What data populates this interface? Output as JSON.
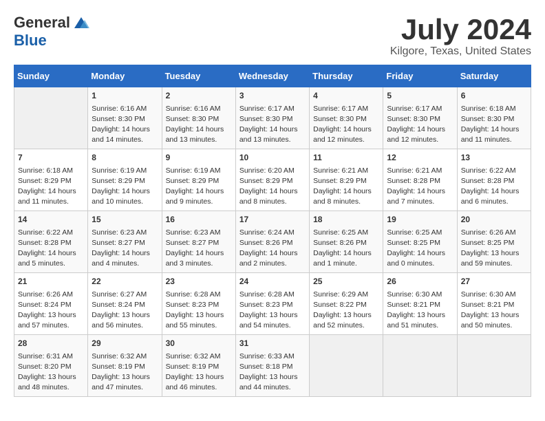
{
  "header": {
    "logo_general": "General",
    "logo_blue": "Blue",
    "month": "July 2024",
    "location": "Kilgore, Texas, United States"
  },
  "days_of_week": [
    "Sunday",
    "Monday",
    "Tuesday",
    "Wednesday",
    "Thursday",
    "Friday",
    "Saturday"
  ],
  "weeks": [
    [
      {
        "day": "",
        "lines": []
      },
      {
        "day": "1",
        "lines": [
          "Sunrise: 6:16 AM",
          "Sunset: 8:30 PM",
          "Daylight: 14 hours",
          "and 14 minutes."
        ]
      },
      {
        "day": "2",
        "lines": [
          "Sunrise: 6:16 AM",
          "Sunset: 8:30 PM",
          "Daylight: 14 hours",
          "and 13 minutes."
        ]
      },
      {
        "day": "3",
        "lines": [
          "Sunrise: 6:17 AM",
          "Sunset: 8:30 PM",
          "Daylight: 14 hours",
          "and 13 minutes."
        ]
      },
      {
        "day": "4",
        "lines": [
          "Sunrise: 6:17 AM",
          "Sunset: 8:30 PM",
          "Daylight: 14 hours",
          "and 12 minutes."
        ]
      },
      {
        "day": "5",
        "lines": [
          "Sunrise: 6:17 AM",
          "Sunset: 8:30 PM",
          "Daylight: 14 hours",
          "and 12 minutes."
        ]
      },
      {
        "day": "6",
        "lines": [
          "Sunrise: 6:18 AM",
          "Sunset: 8:30 PM",
          "Daylight: 14 hours",
          "and 11 minutes."
        ]
      }
    ],
    [
      {
        "day": "7",
        "lines": [
          "Sunrise: 6:18 AM",
          "Sunset: 8:29 PM",
          "Daylight: 14 hours",
          "and 11 minutes."
        ]
      },
      {
        "day": "8",
        "lines": [
          "Sunrise: 6:19 AM",
          "Sunset: 8:29 PM",
          "Daylight: 14 hours",
          "and 10 minutes."
        ]
      },
      {
        "day": "9",
        "lines": [
          "Sunrise: 6:19 AM",
          "Sunset: 8:29 PM",
          "Daylight: 14 hours",
          "and 9 minutes."
        ]
      },
      {
        "day": "10",
        "lines": [
          "Sunrise: 6:20 AM",
          "Sunset: 8:29 PM",
          "Daylight: 14 hours",
          "and 8 minutes."
        ]
      },
      {
        "day": "11",
        "lines": [
          "Sunrise: 6:21 AM",
          "Sunset: 8:29 PM",
          "Daylight: 14 hours",
          "and 8 minutes."
        ]
      },
      {
        "day": "12",
        "lines": [
          "Sunrise: 6:21 AM",
          "Sunset: 8:28 PM",
          "Daylight: 14 hours",
          "and 7 minutes."
        ]
      },
      {
        "day": "13",
        "lines": [
          "Sunrise: 6:22 AM",
          "Sunset: 8:28 PM",
          "Daylight: 14 hours",
          "and 6 minutes."
        ]
      }
    ],
    [
      {
        "day": "14",
        "lines": [
          "Sunrise: 6:22 AM",
          "Sunset: 8:28 PM",
          "Daylight: 14 hours",
          "and 5 minutes."
        ]
      },
      {
        "day": "15",
        "lines": [
          "Sunrise: 6:23 AM",
          "Sunset: 8:27 PM",
          "Daylight: 14 hours",
          "and 4 minutes."
        ]
      },
      {
        "day": "16",
        "lines": [
          "Sunrise: 6:23 AM",
          "Sunset: 8:27 PM",
          "Daylight: 14 hours",
          "and 3 minutes."
        ]
      },
      {
        "day": "17",
        "lines": [
          "Sunrise: 6:24 AM",
          "Sunset: 8:26 PM",
          "Daylight: 14 hours",
          "and 2 minutes."
        ]
      },
      {
        "day": "18",
        "lines": [
          "Sunrise: 6:25 AM",
          "Sunset: 8:26 PM",
          "Daylight: 14 hours",
          "and 1 minute."
        ]
      },
      {
        "day": "19",
        "lines": [
          "Sunrise: 6:25 AM",
          "Sunset: 8:25 PM",
          "Daylight: 14 hours",
          "and 0 minutes."
        ]
      },
      {
        "day": "20",
        "lines": [
          "Sunrise: 6:26 AM",
          "Sunset: 8:25 PM",
          "Daylight: 13 hours",
          "and 59 minutes."
        ]
      }
    ],
    [
      {
        "day": "21",
        "lines": [
          "Sunrise: 6:26 AM",
          "Sunset: 8:24 PM",
          "Daylight: 13 hours",
          "and 57 minutes."
        ]
      },
      {
        "day": "22",
        "lines": [
          "Sunrise: 6:27 AM",
          "Sunset: 8:24 PM",
          "Daylight: 13 hours",
          "and 56 minutes."
        ]
      },
      {
        "day": "23",
        "lines": [
          "Sunrise: 6:28 AM",
          "Sunset: 8:23 PM",
          "Daylight: 13 hours",
          "and 55 minutes."
        ]
      },
      {
        "day": "24",
        "lines": [
          "Sunrise: 6:28 AM",
          "Sunset: 8:23 PM",
          "Daylight: 13 hours",
          "and 54 minutes."
        ]
      },
      {
        "day": "25",
        "lines": [
          "Sunrise: 6:29 AM",
          "Sunset: 8:22 PM",
          "Daylight: 13 hours",
          "and 52 minutes."
        ]
      },
      {
        "day": "26",
        "lines": [
          "Sunrise: 6:30 AM",
          "Sunset: 8:21 PM",
          "Daylight: 13 hours",
          "and 51 minutes."
        ]
      },
      {
        "day": "27",
        "lines": [
          "Sunrise: 6:30 AM",
          "Sunset: 8:21 PM",
          "Daylight: 13 hours",
          "and 50 minutes."
        ]
      }
    ],
    [
      {
        "day": "28",
        "lines": [
          "Sunrise: 6:31 AM",
          "Sunset: 8:20 PM",
          "Daylight: 13 hours",
          "and 48 minutes."
        ]
      },
      {
        "day": "29",
        "lines": [
          "Sunrise: 6:32 AM",
          "Sunset: 8:19 PM",
          "Daylight: 13 hours",
          "and 47 minutes."
        ]
      },
      {
        "day": "30",
        "lines": [
          "Sunrise: 6:32 AM",
          "Sunset: 8:19 PM",
          "Daylight: 13 hours",
          "and 46 minutes."
        ]
      },
      {
        "day": "31",
        "lines": [
          "Sunrise: 6:33 AM",
          "Sunset: 8:18 PM",
          "Daylight: 13 hours",
          "and 44 minutes."
        ]
      },
      {
        "day": "",
        "lines": []
      },
      {
        "day": "",
        "lines": []
      },
      {
        "day": "",
        "lines": []
      }
    ]
  ]
}
